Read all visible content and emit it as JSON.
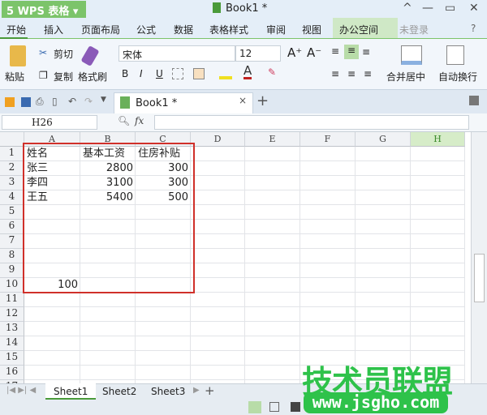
{
  "app": {
    "logo": "5 WPS 表格 ▾",
    "title": "Book1 *",
    "controls": [
      "^",
      "—",
      "▭",
      "✕"
    ]
  },
  "menu": [
    "开始",
    "插入",
    "页面布局",
    "公式",
    "数据",
    "表格样式",
    "审阅",
    "视图",
    "办公空间"
  ],
  "menu_right": {
    "login": "未登录",
    "help": "?"
  },
  "ribbon": {
    "paste": "粘贴",
    "cut": "剪切",
    "copy": "复制",
    "format_painter": "格式刷",
    "font": "宋体",
    "size": "12",
    "bold": "B",
    "italic": "I",
    "underline": "U",
    "grow": "A⁺",
    "shrink": "A⁻",
    "merge": "合并居中",
    "wrap": "自动换行"
  },
  "doc_tab": {
    "label": "Book1 *",
    "close": "×",
    "add": "+"
  },
  "formula_bar": {
    "name_box": "H26",
    "fx": "fx",
    "value": ""
  },
  "columns": [
    "A",
    "B",
    "C",
    "D",
    "E",
    "F",
    "G",
    "H"
  ],
  "selected_column": "H",
  "rows": [
    "1",
    "2",
    "3",
    "4",
    "5",
    "6",
    "7",
    "8",
    "9",
    "10",
    "11",
    "12",
    "13",
    "14",
    "15",
    "16",
    "17"
  ],
  "cells": [
    {
      "r": 0,
      "c": 0,
      "v": "姓名"
    },
    {
      "r": 0,
      "c": 1,
      "v": "基本工资"
    },
    {
      "r": 0,
      "c": 2,
      "v": "住房补贴"
    },
    {
      "r": 1,
      "c": 0,
      "v": "张三"
    },
    {
      "r": 1,
      "c": 1,
      "v": "2800",
      "n": true
    },
    {
      "r": 1,
      "c": 2,
      "v": "300",
      "n": true
    },
    {
      "r": 2,
      "c": 0,
      "v": "李四"
    },
    {
      "r": 2,
      "c": 1,
      "v": "3100",
      "n": true
    },
    {
      "r": 2,
      "c": 2,
      "v": "300",
      "n": true
    },
    {
      "r": 3,
      "c": 0,
      "v": "王五"
    },
    {
      "r": 3,
      "c": 1,
      "v": "5400",
      "n": true
    },
    {
      "r": 3,
      "c": 2,
      "v": "500",
      "n": true
    },
    {
      "r": 9,
      "c": 0,
      "v": "100",
      "n": true
    }
  ],
  "sheets": [
    "Sheet1",
    "Sheet2",
    "Sheet3"
  ],
  "active_sheet": "Sheet1",
  "watermark": {
    "line1": "技术员联盟",
    "line2": "www.jsgho.com"
  },
  "colors": {
    "accent": "#7cc46a",
    "highlight": "#d0302a",
    "watermark": "#2ec24a"
  }
}
